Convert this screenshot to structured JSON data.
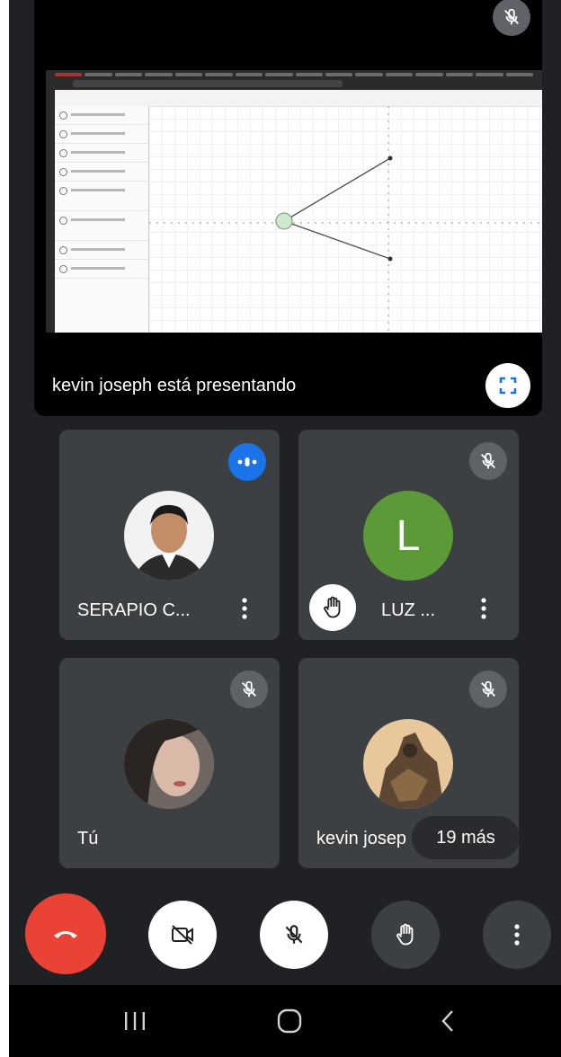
{
  "presentation": {
    "label": "kevin joseph está presentando",
    "fullscreen_icon": "fullscreen-icon",
    "mic_state": "muted"
  },
  "participants": [
    {
      "name": "SERAPIO C...",
      "status_icon": "speaking-indicator-icon",
      "avatar": "photo"
    },
    {
      "name": "LUZ ...",
      "initial": "L",
      "avatar_color": "#5b9a37",
      "status_icon": "mic-off-icon",
      "hand_raised": true
    },
    {
      "name": "Tú",
      "status_icon": "mic-off-icon",
      "avatar": "photo"
    },
    {
      "name": "kevin josep",
      "status_icon": "mic-off-icon",
      "avatar": "photo"
    }
  ],
  "more_participants": "19 más",
  "controls": [
    "end-call-button",
    "camera-off-button",
    "mic-off-button",
    "raise-hand-button",
    "more-options-button"
  ],
  "colors": {
    "end_call": "#ea4335",
    "speaking": "#1a73e8",
    "tile_bg": "#3c4043",
    "app_bg": "#202124"
  },
  "nav_bar": [
    "recents-icon",
    "home-icon",
    "back-icon"
  ]
}
